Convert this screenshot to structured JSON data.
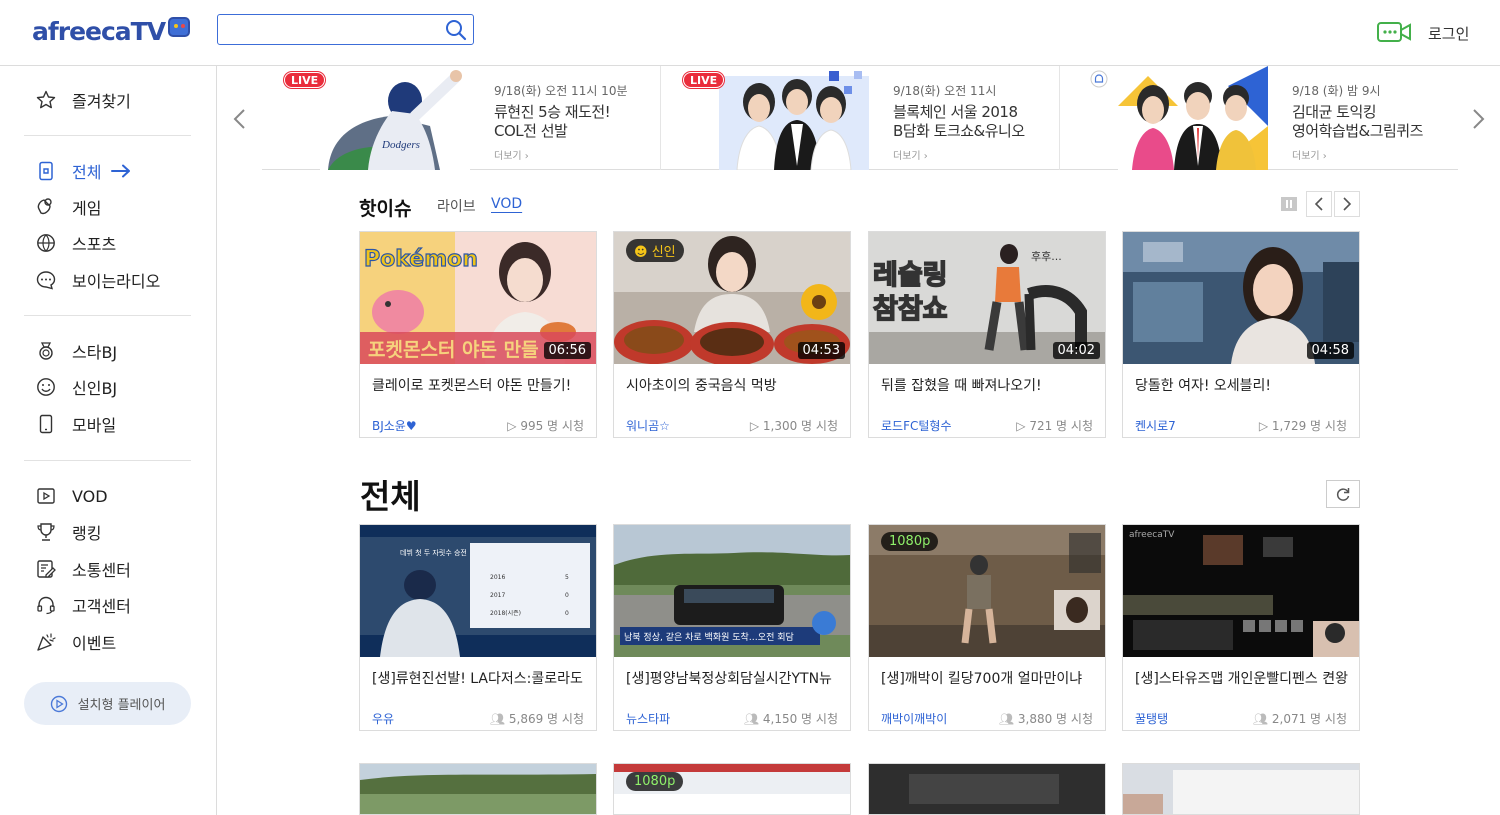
{
  "header": {
    "logo": "afreecaTV",
    "search": {
      "value": "",
      "placeholder": ""
    },
    "login": "로그인"
  },
  "sidebar": {
    "favorites": "즐겨찾기",
    "group1": [
      {
        "label": "전체",
        "icon": "all-icon",
        "active": true
      },
      {
        "label": "게임",
        "icon": "game-icon"
      },
      {
        "label": "스포츠",
        "icon": "sports-icon"
      },
      {
        "label": "보이는라디오",
        "icon": "radio-icon"
      }
    ],
    "group2": [
      {
        "label": "스타BJ",
        "icon": "medal-icon"
      },
      {
        "label": "신인BJ",
        "icon": "smile-icon"
      },
      {
        "label": "모바일",
        "icon": "mobile-icon"
      }
    ],
    "group3": [
      {
        "label": "VOD",
        "icon": "vod-icon"
      },
      {
        "label": "랭킹",
        "icon": "trophy-icon"
      },
      {
        "label": "소통센터",
        "icon": "board-icon"
      },
      {
        "label": "고객센터",
        "icon": "headset-icon"
      },
      {
        "label": "이벤트",
        "icon": "party-icon"
      }
    ],
    "player_button": "설치형 플레이어"
  },
  "banners": [
    {
      "live": "LIVE",
      "date": "9/18(화) 오전 11시 10분",
      "title1": "류현진 5승 재도전!",
      "title2": "COL전 선발",
      "more": "더보기 ›"
    },
    {
      "live": "LIVE",
      "date": "9/18(화) 오전 11시",
      "title1": "블록체인 서울 2018",
      "title2": "B담화 토크쇼&유니오",
      "more": "더보기 ›"
    },
    {
      "live": "",
      "date": "9/18 (화) 밤 9시",
      "title1": "김대균 토익킹",
      "title2": "영어학습법&그림퀴즈",
      "more": "더보기 ›"
    }
  ],
  "hot": {
    "title": "핫이슈",
    "tabs": [
      "라이브",
      "VOD"
    ],
    "cards": [
      {
        "title": "클레이로 포켓몬스터 야돈 만들기!",
        "user": "BJ소윤♥",
        "views": "▷ 995 명 시청",
        "duration": "06:56",
        "badge": ""
      },
      {
        "title": "시아초이의 중국음식 먹방",
        "user": "워니곰☆",
        "views": "▷ 1,300 명 시청",
        "duration": "04:53",
        "badge": "신인"
      },
      {
        "title": "뒤를 잡혔을 때 빠져나오기!",
        "user": "로드FC털형수",
        "views": "▷ 721 명 시청",
        "duration": "04:02",
        "badge": ""
      },
      {
        "title": "당돌한 여자! 오세블리!",
        "user": "켄시로7",
        "views": "▷ 1,729 명 시청",
        "duration": "04:58",
        "badge": ""
      }
    ]
  },
  "all": {
    "title": "전체",
    "cards": [
      {
        "title": "[생]류현진선발! LA다저스:콜로라도",
        "user": "우유",
        "views": "5,869 명 시청",
        "badge": ""
      },
      {
        "title": "[생]평양남북정상회담실시간YTN뉴",
        "user": "뉴스타파",
        "views": "4,150 명 시청",
        "badge": ""
      },
      {
        "title": "[생]깨박이 킬당700개 얼마만이냐",
        "user": "깨박이깨박이",
        "views": "3,880 명 시청",
        "badge": "1080p"
      },
      {
        "title": "[생]스타유즈맵 개인운빨디펜스 켠왕",
        "user": "꿀탱탱",
        "views": "2,071 명 시청",
        "badge": ""
      }
    ],
    "next_row_badge": "1080p"
  }
}
